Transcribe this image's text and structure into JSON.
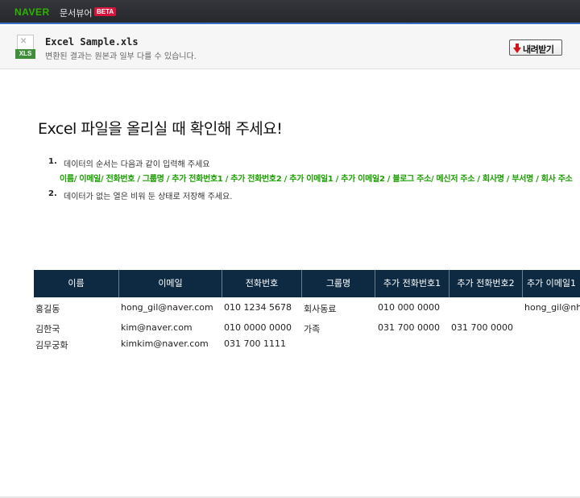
{
  "header": {
    "brand": "NAVER",
    "service": "문서뷰어",
    "beta": "BETA",
    "brand_color": "#2db400",
    "beta_color": "#d7143a",
    "accent_line": "#3b6fc4"
  },
  "file": {
    "name": "Excel Sample.xls",
    "note": "변환된 결과는 원본과 일부 다를 수 있습니다.",
    "icon": "xls-file-icon",
    "icon_tag": "XLS",
    "download_label": "내려받기",
    "download_icon": "red-down-arrow-icon"
  },
  "doc": {
    "title": "Excel 파일을 올리실 때 확인해 주세요!",
    "steps": [
      {
        "num": "1.",
        "text": "데이터의 순서는  다음과 같이 입력해 주세요"
      },
      {
        "num": "2.",
        "text": "데이터가 없는 열은 비워 둔 상태로 저장해 주세요."
      }
    ],
    "field_order": "이름/ 이메일/ 전화번호 / 그룹명 / 추가 전화번호1 / 추가 전화번호2 / 추가 이메일1 / 추가 이메일2 / 블로그 주소/ 메신저 주소 / 회사명 / 부서명 / 회사 주소",
    "field_order_color": "#1aa000"
  },
  "sheet": {
    "header_color": "#0e2a42",
    "columns": [
      "이름",
      "이메일",
      "전화번호",
      "그룹명",
      "추가 전화번호1",
      "추가 전화번호2",
      "추가 이메일1"
    ],
    "rows": [
      [
        "홍길동",
        "hong_gil@naver.com",
        "010 1234 5678",
        "회사동료",
        "010 000 0000",
        "",
        "hong_gil@nhn.com"
      ],
      [
        "김한국",
        "kim@naver.com",
        "010 0000 0000",
        "가족",
        "031 700 0000",
        "031 700 0000",
        ""
      ],
      [
        "김무궁화",
        "kimkim@naver.com",
        "031 700 1111",
        "",
        "",
        "",
        ""
      ]
    ]
  }
}
